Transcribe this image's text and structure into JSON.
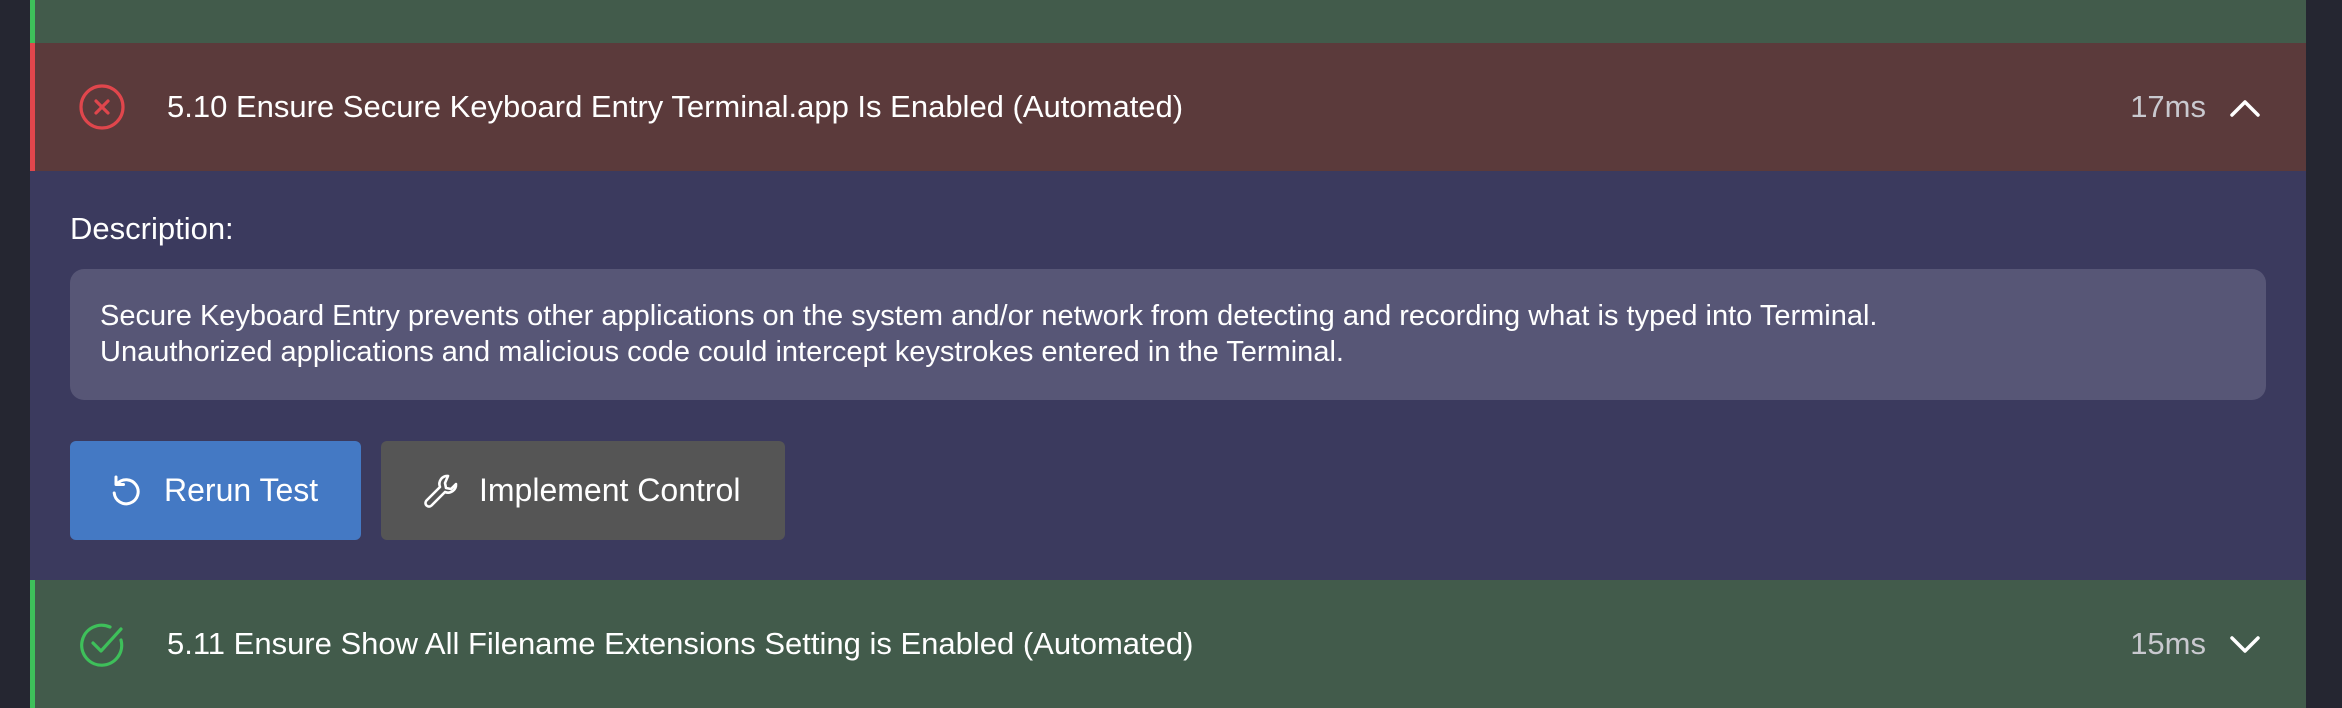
{
  "colors": {
    "fail_accent": "#e0464c",
    "pass_accent": "#3ec05a",
    "fail_bg": "#5b3a3b",
    "pass_bg": "#425b4b",
    "details_bg": "#3b3a5e",
    "primary_button": "#4479c4",
    "secondary_button": "#555555"
  },
  "failed_test": {
    "status": "failed",
    "status_icon": "x-circle-icon",
    "title": "5.10 Ensure Secure Keyboard Entry Terminal.app Is Enabled (Automated)",
    "duration": "17ms",
    "expanded": true,
    "chevron_icon": "chevron-up-icon"
  },
  "details": {
    "description_label": "Description:",
    "description_lines": [
      "Secure Keyboard Entry prevents other applications on the system and/or network from detecting and recording what is typed into Terminal.",
      "Unauthorized applications and malicious code could intercept keystrokes entered in the Terminal."
    ],
    "rerun_button": {
      "label": "Rerun Test",
      "icon": "refresh-icon"
    },
    "implement_button": {
      "label": "Implement Control",
      "icon": "wrench-icon"
    }
  },
  "next_test": {
    "status": "passed",
    "status_icon": "check-circle-icon",
    "title": "5.11 Ensure Show All Filename Extensions Setting is Enabled (Automated)",
    "duration": "15ms",
    "expanded": false,
    "chevron_icon": "chevron-down-icon"
  }
}
